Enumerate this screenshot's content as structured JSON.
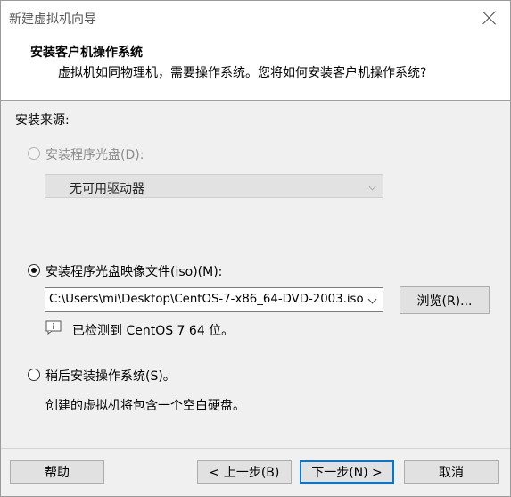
{
  "window": {
    "title": "新建虚拟机向导"
  },
  "header": {
    "title": "安装客户机操作系统",
    "subtitle": "虚拟机如同物理机，需要操作系统。您将如何安装客户机操作系统?"
  },
  "install_source": {
    "label": "安装来源:",
    "option_disc": {
      "label": "安装程序光盘(D):",
      "selected": false,
      "enabled": false,
      "dropdown_value": "无可用驱动器"
    },
    "option_iso": {
      "label": "安装程序光盘映像文件(iso)(M):",
      "selected": true,
      "path_value": "C:\\Users\\mi\\Desktop\\CentOS-7-x86_64-DVD-2003.iso",
      "browse_label": "浏览(R)...",
      "detected_text": "已检测到 CentOS 7 64 位。"
    },
    "option_later": {
      "label": "稍后安装操作系统(S)。",
      "selected": false,
      "description": "创建的虚拟机将包含一个空白硬盘。"
    }
  },
  "footer": {
    "help_label": "帮助",
    "back_label": "< 上一步(B)",
    "next_label": "下一步(N) >",
    "cancel_label": "取消"
  }
}
